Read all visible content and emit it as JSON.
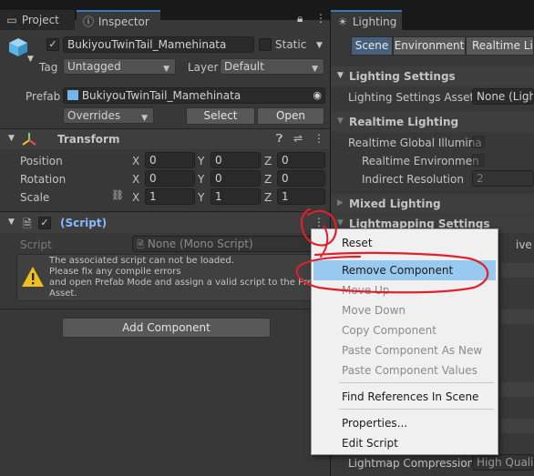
{
  "left_tabs": {
    "project": "Project",
    "inspector": "Inspector"
  },
  "object": {
    "name": "BukiyouTwinTail_Mamehinata",
    "static_label": "Static",
    "tag_label": "Tag",
    "tag_value": "Untagged",
    "layer_label": "Layer",
    "layer_value": "Default"
  },
  "prefab": {
    "label": "Prefab",
    "value": "BukiyouTwinTail_Mamehinata",
    "overrides": "Overrides",
    "select": "Select",
    "open": "Open"
  },
  "transform": {
    "title": "Transform",
    "position_label": "Position",
    "rotation_label": "Rotation",
    "scale_label": "Scale",
    "x": "X",
    "y": "Y",
    "z": "Z",
    "position": [
      "0",
      "0",
      "0"
    ],
    "rotation": [
      "0",
      "0",
      "0"
    ],
    "scale": [
      "1",
      "1",
      "1"
    ]
  },
  "script_comp": {
    "title": "(Script)",
    "script_label": "Script",
    "script_value": "None (Mono Script)",
    "warning_lines": [
      "The associated script can not be loaded.",
      "Please fix any compile errors",
      "and open Prefab Mode and assign a valid script to the Prefa",
      "Asset."
    ]
  },
  "add_component": "Add Component",
  "lighting": {
    "tab": "Lighting",
    "subtabs": [
      "Scene",
      "Environment",
      "Realtime Lig"
    ],
    "settings_header": "Lighting Settings",
    "asset_label": "Lighting Settings Asset",
    "asset_value": "None (Light",
    "realtime_header": "Realtime Lighting",
    "rt_gi_label": "Realtime Global Illumina",
    "rt_env_label": "Realtime Environmen",
    "indirect_label": "Indirect Resolution",
    "indirect_value": "2",
    "mixed_header": "Mixed Lighting",
    "lightmapping_header": "Lightmapping Settings",
    "partial_right": "ive",
    "compression_label": "Lightmap Compression",
    "compression_value": "High Quality"
  },
  "context_menu": {
    "items": [
      {
        "label": "Reset",
        "enabled": true
      },
      {
        "label": "Remove Component",
        "enabled": true,
        "highlighted": true
      },
      {
        "label": "Move Up",
        "enabled": false
      },
      {
        "label": "Move Down",
        "enabled": false
      },
      {
        "label": "Copy Component",
        "enabled": false
      },
      {
        "label": "Paste Component As New",
        "enabled": false
      },
      {
        "label": "Paste Component Values",
        "enabled": false
      },
      {
        "label": "Find References In Scene",
        "enabled": true
      },
      {
        "label": "Properties...",
        "enabled": true
      },
      {
        "label": "Edit Script",
        "enabled": true
      }
    ]
  },
  "icons": [
    "project-folder-icon",
    "inspector-info-icon",
    "lock-icon",
    "more-icon",
    "cube-prefab-icon",
    "transform-axes-icon",
    "help-icon",
    "presets-icon",
    "script-file-icon",
    "warning-icon",
    "circle-select-icon",
    "link-scale-icon",
    "lighting-icon"
  ],
  "colors": {
    "accent_blue": "#3a79bb",
    "script_title": "#89b7ff",
    "menu_highlight": "#99c9ef",
    "annotation_red": "#e0202a",
    "warning_yellow": "#f0c020"
  }
}
